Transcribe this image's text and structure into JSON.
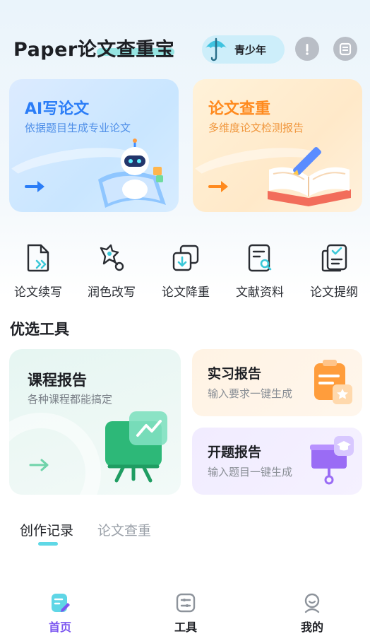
{
  "header": {
    "app_title": "Paper论文查重宝",
    "teen_mode_label": "青少年",
    "warning_icon": "alert-icon",
    "menu_icon": "list-icon"
  },
  "feature_cards": [
    {
      "title": "AI写论文",
      "subtitle": "依据题目生成专业论文"
    },
    {
      "title": "论文查重",
      "subtitle": "多维度论文检测报告"
    }
  ],
  "quick_tools": [
    {
      "label": "论文续写"
    },
    {
      "label": "润色改写"
    },
    {
      "label": "论文降重"
    },
    {
      "label": "文献资料"
    },
    {
      "label": "论文提纲"
    }
  ],
  "preferred": {
    "section_title": "优选工具",
    "course": {
      "title": "课程报告",
      "subtitle": "各种课程都能搞定"
    },
    "intern": {
      "title": "实习报告",
      "subtitle": "输入要求一键生成"
    },
    "proposal": {
      "title": "开题报告",
      "subtitle": "输入题目一键生成"
    }
  },
  "records": {
    "tabs": [
      "创作记录",
      "论文查重"
    ],
    "active_tab": 0
  },
  "bottom_nav": {
    "items": [
      {
        "label": "首页"
      },
      {
        "label": "工具"
      },
      {
        "label": "我的"
      }
    ],
    "active": 0
  },
  "colors": {
    "accent_purple": "#7b56f0",
    "ai_blue": "#2b7df7",
    "check_orange": "#ff8a1e",
    "tab_underline": "#5fd8e6",
    "course_green": "#3cc38a"
  }
}
